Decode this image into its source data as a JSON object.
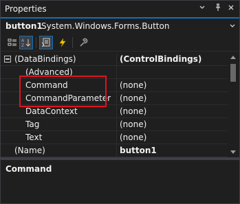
{
  "window": {
    "title": "Properties",
    "dropdown_icon": "chevron-down-icon",
    "pin_icon": "pin-icon",
    "close_icon": "close-icon"
  },
  "selected_object": {
    "name": "button1",
    "type": "System.Windows.Forms.Button"
  },
  "toolbar": {
    "buttons": [
      {
        "name": "categorized-view",
        "icon": "categorized-icon"
      },
      {
        "name": "alphabetical-view",
        "icon": "sort-alphabetical-icon",
        "active": true
      },
      {
        "name": "properties-view",
        "icon": "properties-icon",
        "active": true
      },
      {
        "name": "events-view",
        "icon": "lightning-icon"
      },
      {
        "name": "property-pages",
        "icon": "wrench-icon"
      }
    ]
  },
  "grid": {
    "rows": [
      {
        "name": "(DataBindings)",
        "value": "(ControlBindings)",
        "category": true,
        "expanded": true
      },
      {
        "name": "(Advanced)",
        "value": ""
      },
      {
        "name": "Command",
        "value": "(none)"
      },
      {
        "name": "CommandParameter",
        "value": "(none)"
      },
      {
        "name": "DataContext",
        "value": "(none)"
      },
      {
        "name": "Tag",
        "value": "(none)"
      },
      {
        "name": "Text",
        "value": "(none)"
      },
      {
        "name": "(Name)",
        "value": "button1",
        "bold_value": true
      }
    ]
  },
  "description": {
    "title": "Command"
  },
  "colors": {
    "accent": "#0e70c0",
    "highlight_box": "#e0141e",
    "background": "#1f1f1f"
  }
}
